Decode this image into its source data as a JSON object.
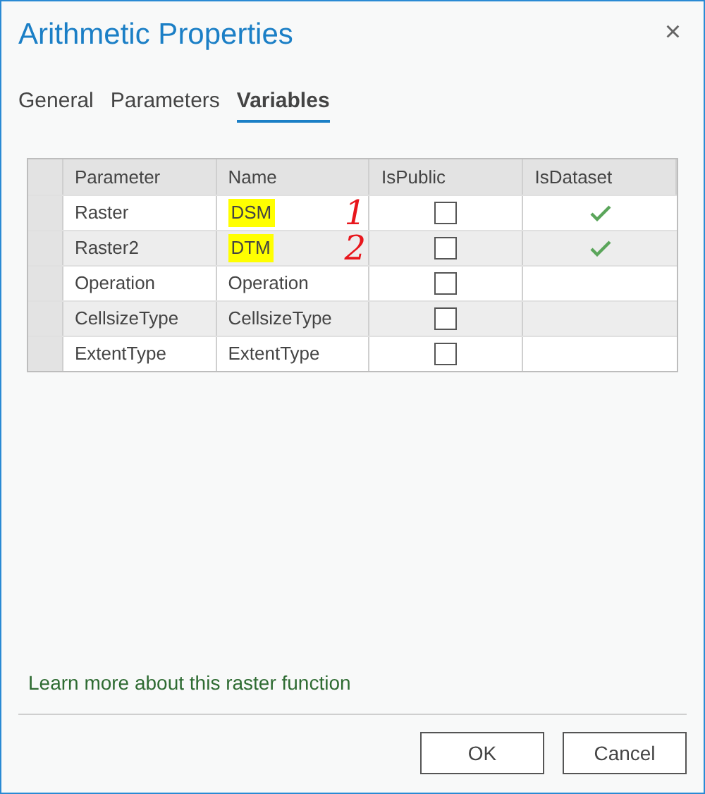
{
  "window": {
    "title": "Arithmetic Properties",
    "close": "×"
  },
  "tabs": [
    {
      "label": "General",
      "selected": false
    },
    {
      "label": "Parameters",
      "selected": false
    },
    {
      "label": "Variables",
      "selected": true
    }
  ],
  "table": {
    "columns": [
      "Parameter",
      "Name",
      "IsPublic",
      "IsDataset"
    ],
    "rows": [
      {
        "parameter": "Raster",
        "name": "DSM",
        "highlighted": true,
        "annotation": "1",
        "is_public": false,
        "is_dataset": true
      },
      {
        "parameter": "Raster2",
        "name": "DTM",
        "highlighted": true,
        "annotation": "2",
        "is_public": false,
        "is_dataset": true
      },
      {
        "parameter": "Operation",
        "name": "Operation",
        "highlighted": false,
        "is_public": false,
        "is_dataset": false
      },
      {
        "parameter": "CellsizeType",
        "name": "CellsizeType",
        "highlighted": false,
        "is_public": false,
        "is_dataset": false
      },
      {
        "parameter": "ExtentType",
        "name": "ExtentType",
        "highlighted": false,
        "is_public": false,
        "is_dataset": false
      }
    ]
  },
  "link": "Learn more about this raster function",
  "buttons": [
    "OK",
    "Cancel"
  ]
}
